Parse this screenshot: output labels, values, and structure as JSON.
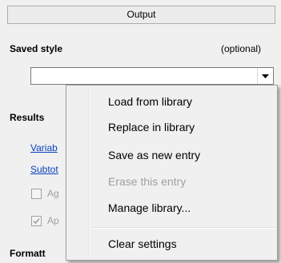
{
  "panel": {
    "tab_title": "Output",
    "saved_style_label": "Saved style",
    "optional_label": "(optional)",
    "combo_value": "",
    "results_label": "Results",
    "link1": "Variab",
    "link2": "Subtot",
    "check1_label": "Ag",
    "check2_label": "Ap",
    "formatting_label": "Formatt"
  },
  "menu": {
    "items": [
      {
        "label": "Load from library",
        "enabled": true
      },
      {
        "label": "Replace in library",
        "enabled": true
      },
      {
        "label": "Save as new entry",
        "enabled": true
      },
      {
        "label": "Erase this entry",
        "enabled": false
      },
      {
        "label": "Manage library...",
        "enabled": true
      },
      {
        "label": "Clear settings",
        "enabled": true
      }
    ]
  },
  "colors": {
    "link": "#0b3fbf",
    "disabled_text": "#a0a0a0",
    "menu_bg": "#f0f0f0"
  }
}
